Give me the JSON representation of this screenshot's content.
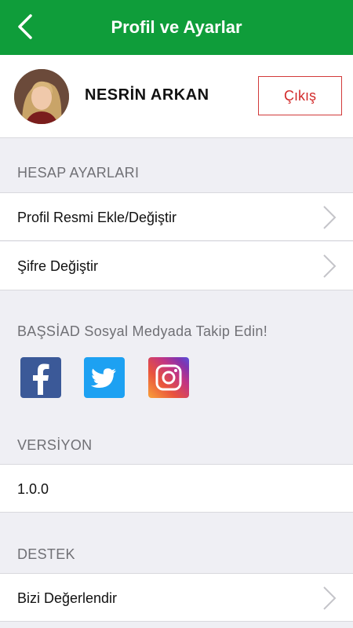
{
  "header": {
    "title": "Profil ve Ayarlar",
    "back_icon": "chevron-left-icon"
  },
  "profile": {
    "name": "NESRİN ARKAN",
    "logout_label": "Çıkış",
    "avatar_icon": "user-avatar"
  },
  "account": {
    "section_title": "HESAP AYARLARI",
    "items": [
      {
        "label": "Profil Resmi Ekle/Değiştir"
      },
      {
        "label": "Şifre Değiştir"
      }
    ]
  },
  "social": {
    "section_title": "BAŞSİAD Sosyal Medyada Takip Edin!",
    "networks": [
      {
        "icon": "facebook-icon",
        "color": "#3b5998"
      },
      {
        "icon": "twitter-icon",
        "color": "#1da1f2"
      },
      {
        "icon": "instagram-icon",
        "color": "#c13584"
      }
    ]
  },
  "version": {
    "section_title": "VERSİYON",
    "value": "1.0.0"
  },
  "support": {
    "section_title": "DESTEK",
    "items": [
      {
        "label": "Bizi Değerlendir"
      }
    ]
  },
  "colors": {
    "brand": "#0f9d3a",
    "danger": "#d22a2a"
  }
}
